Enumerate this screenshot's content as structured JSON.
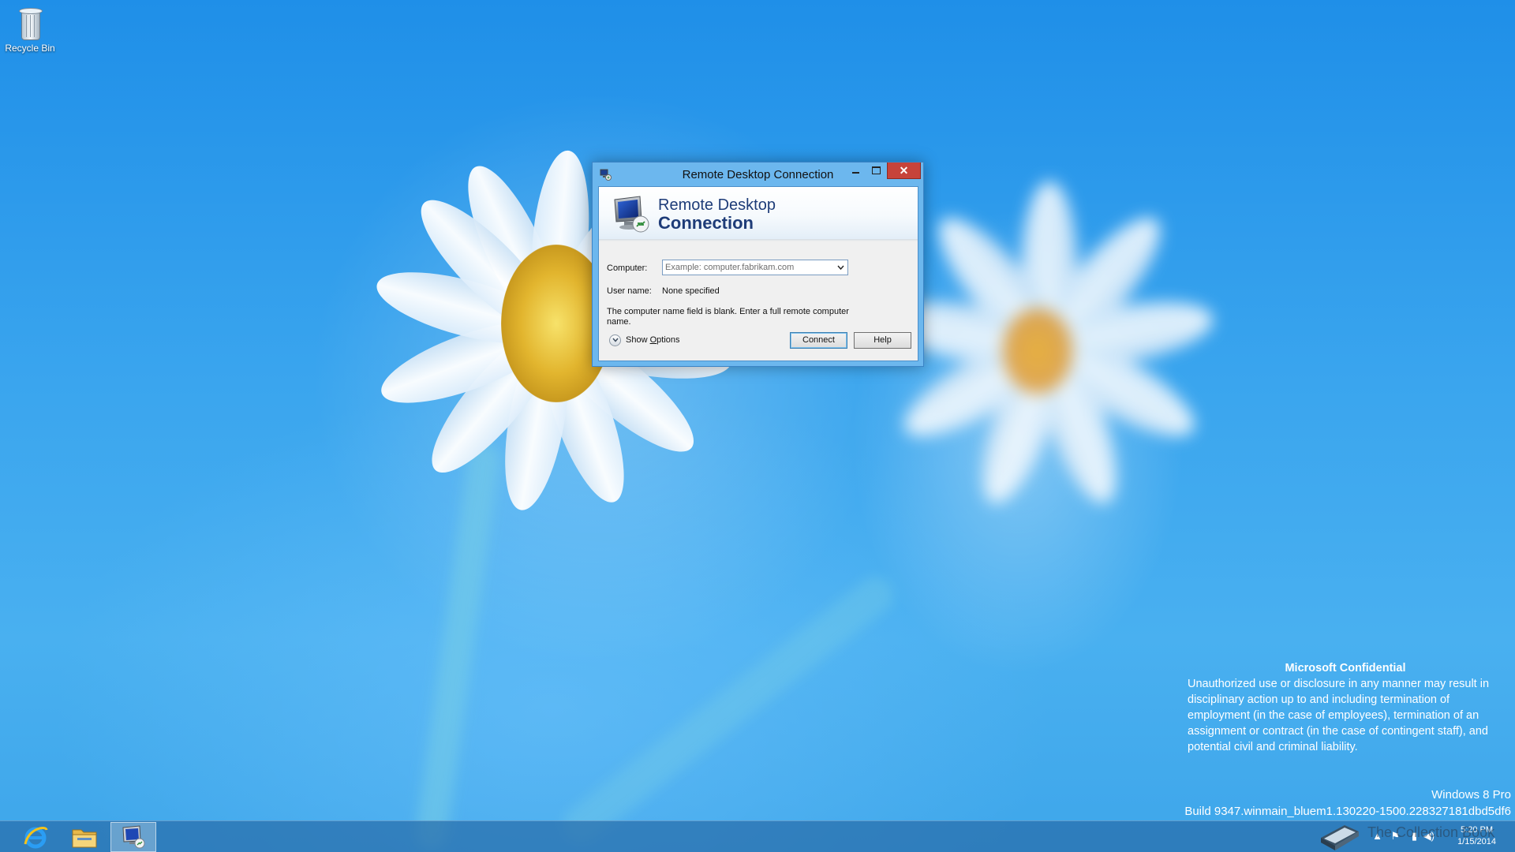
{
  "desktop": {
    "icons": [
      {
        "label": "Recycle Bin",
        "icon": "recycle-bin-icon"
      }
    ],
    "confidential": {
      "title": "Microsoft Confidential",
      "body": "Unauthorized use or disclosure in any manner may result in disciplinary action up to and including termination of employment (in the case of employees), termination of an assignment or contract (in the case of contingent staff), and potential civil and criminal liability."
    },
    "edition": "Windows 8 Pro",
    "build": "Build 9347.winmain_bluem1.130220-1500.228327181dbd5df6",
    "watermark": "The Collection Book"
  },
  "dialog": {
    "title": "Remote Desktop Connection",
    "banner_line1": "Remote Desktop",
    "banner_line2": "Connection",
    "computer_label": "Computer:",
    "computer_value": "",
    "computer_placeholder": "Example: computer.fabrikam.com",
    "username_label": "User name:",
    "username_value": "None specified",
    "message": "The computer name field is blank. Enter a full remote computer name.",
    "show_options_prefix": "Show ",
    "show_options_hotkey": "O",
    "show_options_suffix": "ptions",
    "connect_label": "Connect",
    "help_label": "Help",
    "close_glyph": "✕"
  },
  "taskbar": {
    "items": [
      {
        "name": "Internet Explorer",
        "icon": "internet-explorer-icon"
      },
      {
        "name": "File Explorer",
        "icon": "file-explorer-icon"
      },
      {
        "name": "Remote Desktop Connection",
        "icon": "remote-desktop-icon",
        "active": true
      }
    ],
    "tray_icons": [
      "show-hidden-icons-arrow",
      "action-center-flag-icon",
      "network-icon",
      "volume-icon"
    ],
    "clock_time": "5:20 PM",
    "clock_date": "1/15/2014"
  },
  "colors": {
    "wallpaper": "#3aa5ee",
    "window_frame": "#6cb7ee",
    "close_button": "#c7433a",
    "banner_text": "#1e3c78",
    "taskbar": "#286eaa"
  }
}
